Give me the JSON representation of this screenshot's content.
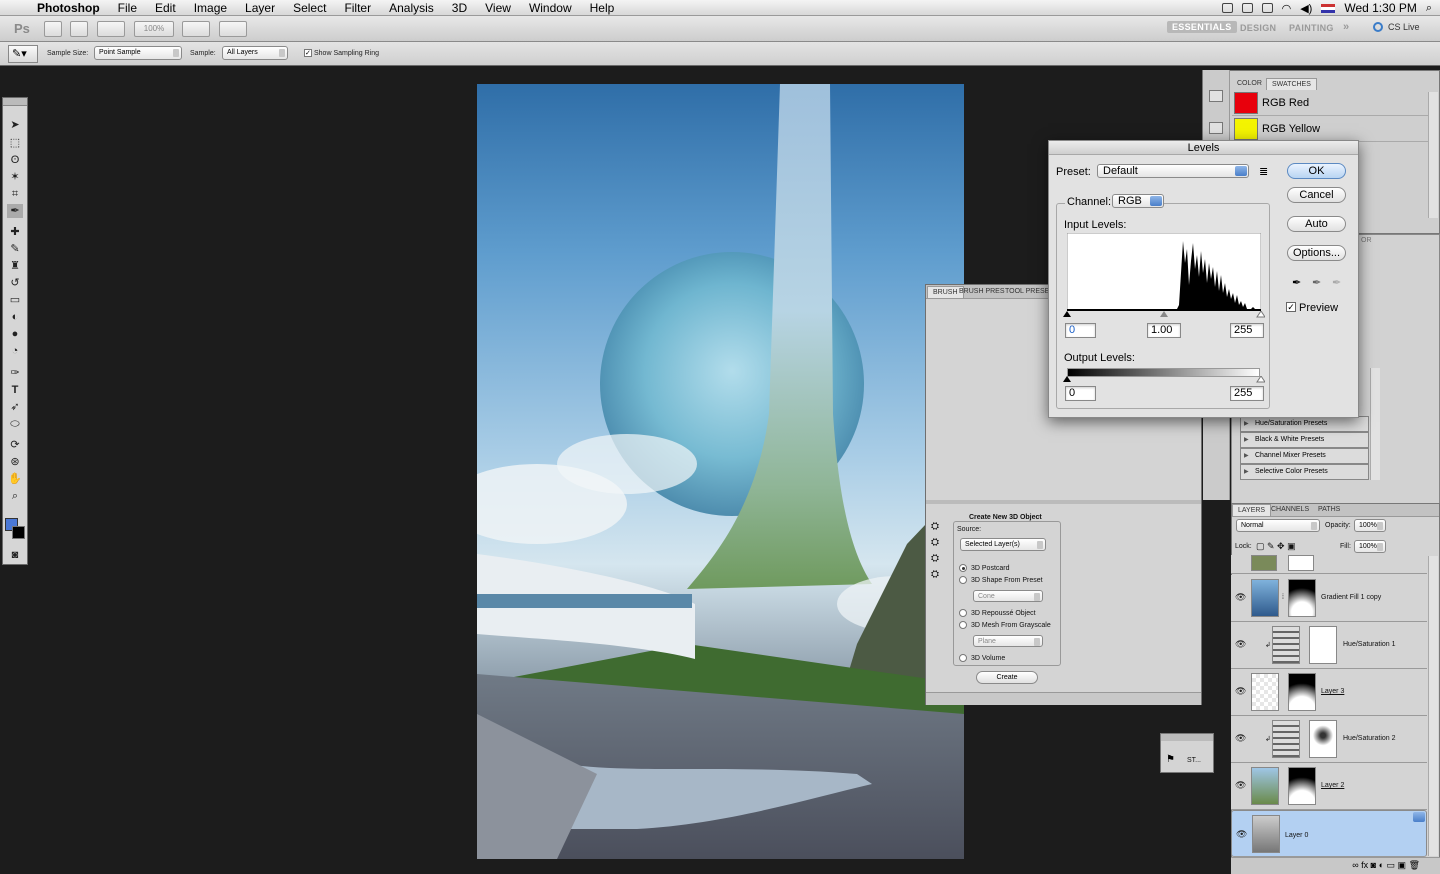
{
  "menubar": {
    "app": "Photoshop",
    "items": [
      "File",
      "Edit",
      "Image",
      "Layer",
      "Select",
      "Filter",
      "Analysis",
      "3D",
      "View",
      "Window",
      "Help"
    ],
    "clock": "Wed 1:30 PM"
  },
  "appbar": {
    "logo": "Ps",
    "zoom": "100%",
    "workspaces": [
      "ESSENTIALS",
      "DESIGN",
      "PAINTING"
    ],
    "more": "»",
    "cslive": "CS Live"
  },
  "options": {
    "sample_size_label": "Sample Size:",
    "sample_size_value": "Point Sample",
    "sample_label": "Sample:",
    "sample_value": "All Layers",
    "show_ring_label": "Show Sampling Ring"
  },
  "swatches": {
    "tabs": [
      "COLOR",
      "SWATCHES"
    ],
    "items": [
      {
        "name": "RGB Red",
        "color": "#e8000c"
      },
      {
        "name": "RGB Yellow",
        "color": "#f4f400"
      }
    ]
  },
  "adjustments": {
    "tab_fragment": "OR",
    "presets": [
      "Hue/Saturation Presets",
      "Black & White Presets",
      "Channel Mixer Presets",
      "Selective Color Presets"
    ]
  },
  "levels": {
    "title": "Levels",
    "preset_label": "Preset:",
    "preset_value": "Default",
    "channel_label": "Channel:",
    "channel_value": "RGB",
    "input_levels_label": "Input Levels:",
    "input_black": "0",
    "input_gamma": "1.00",
    "input_white": "255",
    "output_levels_label": "Output Levels:",
    "output_black": "0",
    "output_white": "255",
    "buttons": {
      "ok": "OK",
      "cancel": "Cancel",
      "auto": "Auto",
      "options": "Options..."
    },
    "preview_label": "Preview",
    "preview_checked": true
  },
  "brush_panel": {
    "tabs": [
      "BRUSH",
      "BRUSH PRES",
      "TOOL PRESE"
    ],
    "section_title": "Create New 3D Object",
    "source_label": "Source:",
    "source_value": "Selected Layer(s)",
    "options": [
      "3D Postcard",
      "3D Shape From Preset",
      "3D Repoussé Object",
      "3D Mesh From Grayscale",
      "3D Volume"
    ],
    "shape_value": "Cone",
    "mesh_value": "Plane",
    "create_label": "Create",
    "selected_option": "3D Postcard"
  },
  "mini_panel": {
    "label": "ST..."
  },
  "layers": {
    "tabs": [
      "LAYERS",
      "CHANNELS",
      "PATHS"
    ],
    "blend_mode": "Normal",
    "opacity_label": "Opacity:",
    "opacity_value": "100%",
    "lock_label": "Lock:",
    "fill_label": "Fill:",
    "fill_value": "100%",
    "items": [
      "Gradient Fill 1 copy",
      "Hue/Saturation 1",
      "Layer 3",
      "Hue/Saturation 2",
      "Layer 2",
      "Layer 0"
    ],
    "selected": "Layer 0"
  }
}
